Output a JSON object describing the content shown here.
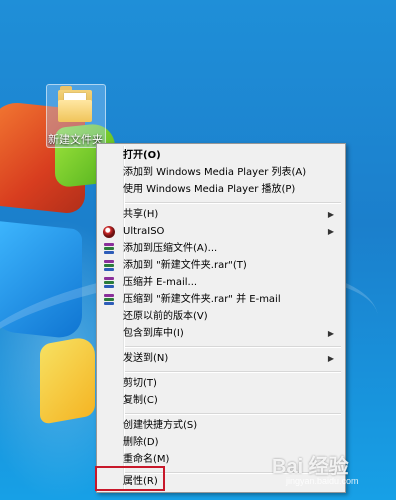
{
  "desktop": {
    "folder": {
      "label": "新建文件夹",
      "icon": "folder-icon"
    }
  },
  "context_menu": {
    "groups": [
      [
        {
          "label": "打开(O)",
          "bold": true
        },
        {
          "label": "添加到 Windows Media Player 列表(A)"
        },
        {
          "label": "使用 Windows Media Player 播放(P)"
        }
      ],
      [
        {
          "label": "共享(H)",
          "submenu": true
        },
        {
          "label": "UltraISO",
          "submenu": true,
          "icon": "ultraiso-icon"
        },
        {
          "label": "添加到压缩文件(A)...",
          "icon": "winrar-icon"
        },
        {
          "label": "添加到 \"新建文件夹.rar\"(T)",
          "icon": "winrar-icon"
        },
        {
          "label": "压缩并 E-mail...",
          "icon": "winrar-icon"
        },
        {
          "label": "压缩到 \"新建文件夹.rar\" 并 E-mail",
          "icon": "winrar-icon"
        },
        {
          "label": "还原以前的版本(V)"
        },
        {
          "label": "包含到库中(I)",
          "submenu": true
        }
      ],
      [
        {
          "label": "发送到(N)",
          "submenu": true
        }
      ],
      [
        {
          "label": "剪切(T)"
        },
        {
          "label": "复制(C)"
        }
      ],
      [
        {
          "label": "创建快捷方式(S)"
        },
        {
          "label": "删除(D)"
        },
        {
          "label": "重命名(M)"
        }
      ],
      [
        {
          "label": "属性(R)",
          "highlighted": true
        }
      ]
    ]
  },
  "watermark": {
    "main": "Bai 经验",
    "sub": "jingyan.baidu.com"
  },
  "colors": {
    "highlight_border": "#c8182a",
    "menu_bg": "#f0f0f0"
  }
}
